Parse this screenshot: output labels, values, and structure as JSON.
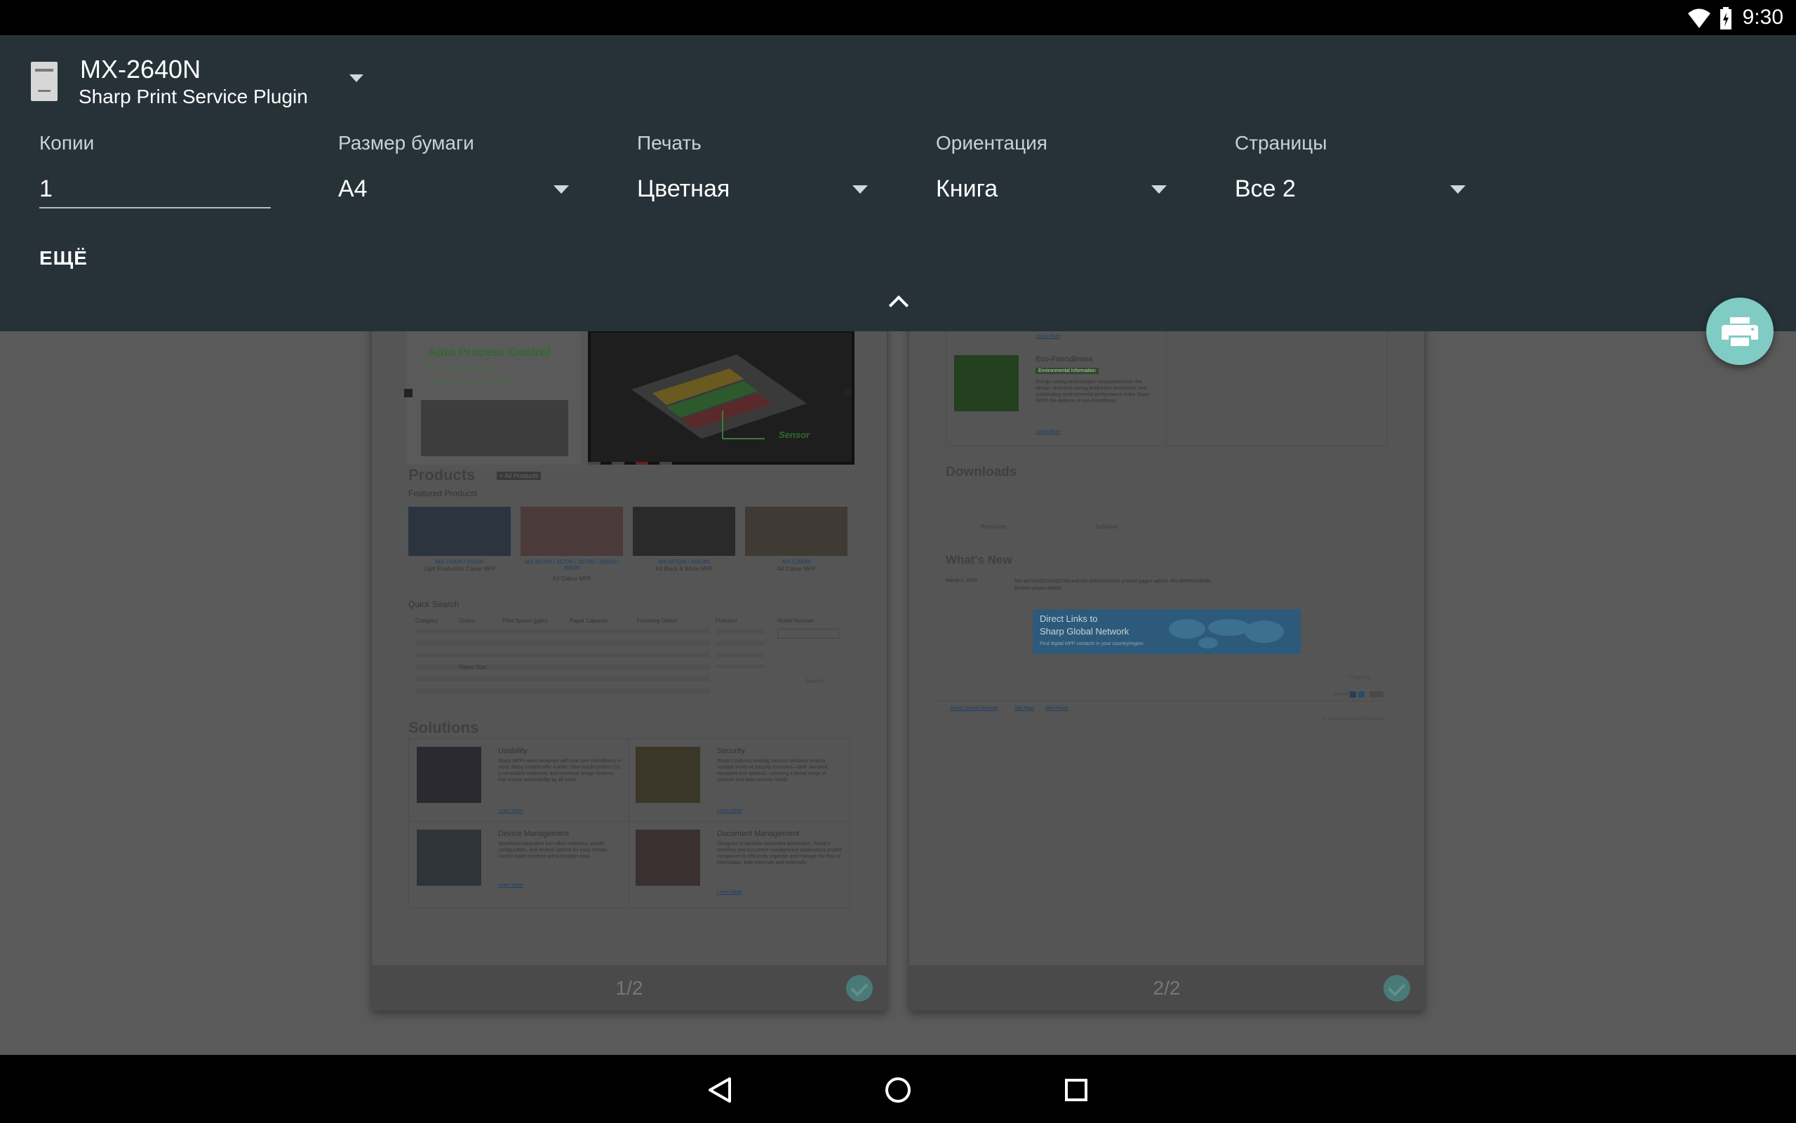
{
  "status_bar": {
    "time": "9:30"
  },
  "printer": {
    "name": "MX-2640N",
    "service": "Sharp Print Service Plugin"
  },
  "options": {
    "copies": {
      "label": "Копии",
      "value": "1"
    },
    "paper_size": {
      "label": "Размер бумаги",
      "value": "A4"
    },
    "color": {
      "label": "Печать",
      "value": "Цветная"
    },
    "orientation": {
      "label": "Ориентация",
      "value": "Книга"
    },
    "pages": {
      "label": "Страницы",
      "value": "Все 2"
    },
    "more_label": "ЕЩЁ"
  },
  "colors": {
    "panel": "#263238",
    "fab": "#80cbc4",
    "overlay": "#5a5a5a"
  },
  "preview": {
    "page1": {
      "number_label": "1/2",
      "banner_title": "Auto Process Control",
      "banner_sub1": "for Consistently",
      "banner_sub2": "High Image Quality",
      "sensor_label": "Sensor",
      "products_heading": "Products",
      "all_products": "+ All Products",
      "featured_label": "Featured Products",
      "featured": [
        {
          "model": "MX-7500N / 6500N",
          "desc": "Light Production Colour MFP"
        },
        {
          "model": "MX-4070N / 3570N / 3070N / 3060N / 2060N",
          "desc": "A3 Colour MFP"
        },
        {
          "model": "MX-M754N / M654N",
          "desc": "A3 Black & White MFP"
        },
        {
          "model": "MX-C300W",
          "desc": "A4 Colour MFP"
        }
      ],
      "quick_search": "Quick Search",
      "qs_columns": [
        "Category",
        "Colour",
        "Print Speed (ppm)",
        "Paper Capacity",
        "Finishing Option",
        "Function",
        "Model Number"
      ],
      "qs_paper_size": "Paper Size",
      "qs_search": "Search",
      "solutions_heading": "Solutions",
      "solutions": [
        {
          "title": "Usability",
          "text": "Sharp MFPs were designed with true user-friendliness in mind. Many models offer a wide, clear touchscreen LCD, a retractable keyboard, and universal design features that ensure accessibility by all users.",
          "link": "Learn More"
        },
        {
          "title": "Security",
          "text": "Sharp's industry-leading security solutions employ multiple levels of security functions—both standard equipped and optional—covering a broad range of network and data security needs.",
          "link": "Learn More"
        },
        {
          "title": "Device Management",
          "text": "Seamless integration into office networks, simple configuration, and several options for easy remote control make machine administration easy.",
          "link": "Learn More"
        },
        {
          "title": "Document Management",
          "text": "Designed to facilitate document distribution, Sharp's workflow and document management applications enable companies to efficiently organise and manage the flow of information, both internally and externally.",
          "link": "Learn More"
        }
      ]
    },
    "page2": {
      "number_label": "2/2",
      "top_link": "Learn More",
      "eco_title": "Eco-Friendliness",
      "eco_badge": "Environmental Information",
      "eco_text": "Energy-saving technologies incorporated into the design, resource-saving production processes, and outstanding environmental performance make Sharp MFPs the epitome of eco-friendliness.",
      "eco_link": "Learn More",
      "downloads_heading": "Downloads",
      "downloads_items": [
        "Brochures",
        "Software"
      ],
      "whats_new_heading": "What's New",
      "news_date": "March 6, 2014",
      "news_text": "MX-4070N/3570N/3070N and MX-3060N/3060N product pages added. MX-4050N/M400N product pages added.",
      "banner_line1": "Direct Links to",
      "banner_line2": "Sharp Global Network",
      "banner_line3": "Find digital MFP contacts in your country/region",
      "page_top": "^ Page top",
      "share_label": "SHARE",
      "footer_links": [
        "Sharp Global Network",
        "Site Map",
        "Site Policy"
      ],
      "copyright": "© 2014 SHARP CORPORATION"
    }
  }
}
